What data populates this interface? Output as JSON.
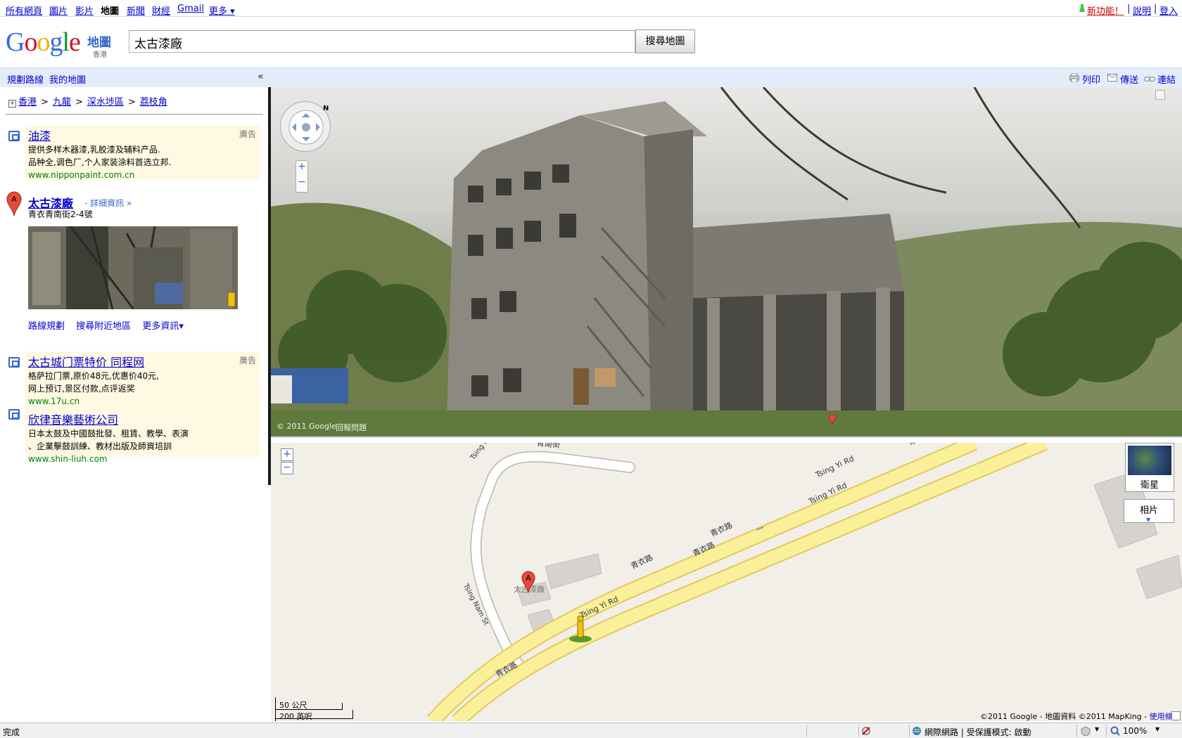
{
  "gbar": {
    "left": [
      "所有網頁",
      "圖片",
      "影片",
      "地圖",
      "新聞",
      "財經",
      "Gmail",
      "更多 ▾"
    ],
    "current": "地圖",
    "new_features": "新功能！",
    "help": "說明",
    "login": "登入"
  },
  "header": {
    "logo_text": "Google",
    "logo_product": "地圖",
    "logo_region": "香港",
    "search_value": "太古漆廠",
    "search_button": "搜尋地圖"
  },
  "panelbar": {
    "directions": "規劃路線",
    "my_maps": "我的地圖",
    "collapse": "«",
    "print": "列印",
    "send": "傳送",
    "link": "連結"
  },
  "breadcrumb": [
    "香港",
    "九龍",
    "深水埗區",
    "荔枝角"
  ],
  "ads_top": {
    "label": "廣告",
    "title": "油漆",
    "lines": [
      "提供多样木器漆,乳胶漆及辅料产品.",
      "品种全,调色厂,个人家装涂料首选立邦."
    ],
    "url": "www.nipponpaint.com.cn"
  },
  "result": {
    "marker": "A",
    "title": "太古漆廠",
    "more_info": "- 詳細資訊 »",
    "address": "青衣青南街2-4號",
    "links": [
      "路線規劃",
      "搜尋附近地區",
      "更多資訊▾"
    ]
  },
  "ads_bottom": {
    "label": "廣告",
    "items": [
      {
        "title": "太古城门票特价 同程网",
        "lines": [
          "格萨拉门票,原价48元,优惠价40元,",
          "网上预订,景区付款,点评返奖"
        ],
        "url": "www.17u.cn"
      },
      {
        "title": "欣律音樂藝術公司",
        "lines": [
          "日本太鼓及中國鼓批發、租賃、教學、表演",
          "、企業擊鼓訓練、教材出版及師資培訓"
        ],
        "url": "www.shin-liuh.com"
      }
    ]
  },
  "streetview": {
    "copyright": "© 2011 Google",
    "report": "回報問題",
    "compass": "N"
  },
  "map": {
    "satellite": "衛星",
    "photos": "相片",
    "marker": "A",
    "place_label": "太古漆廠",
    "scale_metric": "50 公尺",
    "scale_imperial": "200 英呎",
    "copyright": "©2011 Google - 地圖資料 ©2011 MapKing - ",
    "terms": "使用條款",
    "roads": {
      "qingnan_cn": "青南街",
      "tsing_nam_st": "Tsing Nam St",
      "tsing_yi_rd": "Tsing Yi Rd",
      "qingyi_cn": "青衣路"
    }
  },
  "statusbar": {
    "left": "完成",
    "zone": "網際網路 | 受保護模式: 啟動",
    "zoom": "100%"
  }
}
